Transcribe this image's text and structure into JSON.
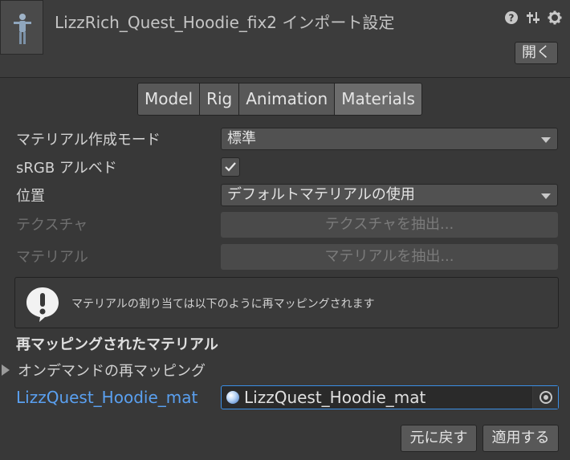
{
  "header": {
    "title": "LizzRich_Quest_Hoodie_fix2 インポート設定",
    "icons": [
      "help-icon",
      "preset-icon",
      "gear-icon"
    ],
    "open_label": "開く"
  },
  "tabs": [
    {
      "label": "Model",
      "active": false
    },
    {
      "label": "Rig",
      "active": false
    },
    {
      "label": "Animation",
      "active": false
    },
    {
      "label": "Materials",
      "active": true
    }
  ],
  "form": {
    "creation_mode_label": "マテリアル作成モード",
    "creation_mode_value": "標準",
    "srgb_label": "sRGB アルベド",
    "srgb_checked": true,
    "location_label": "位置",
    "location_value": "デフォルトマテリアルの使用",
    "textures_label": "テクスチャ",
    "extract_textures_label": "テクスチャを抽出...",
    "materials_label": "マテリアル",
    "extract_materials_label": "マテリアルを抽出..."
  },
  "info": {
    "message": "マテリアルの割り当ては以下のように再マッピングされます"
  },
  "remap": {
    "section_title": "再マッピングされたマテリアル",
    "on_demand_label": "オンデマンドの再マッピング",
    "material_name": "LizzQuest_Hoodie_mat",
    "material_value": "LizzQuest_Hoodie_mat"
  },
  "footer": {
    "revert_label": "元に戻す",
    "apply_label": "適用する"
  },
  "colors": {
    "background": "#383838",
    "accent": "#3b8fe6",
    "link_text": "#5aa0f0"
  }
}
